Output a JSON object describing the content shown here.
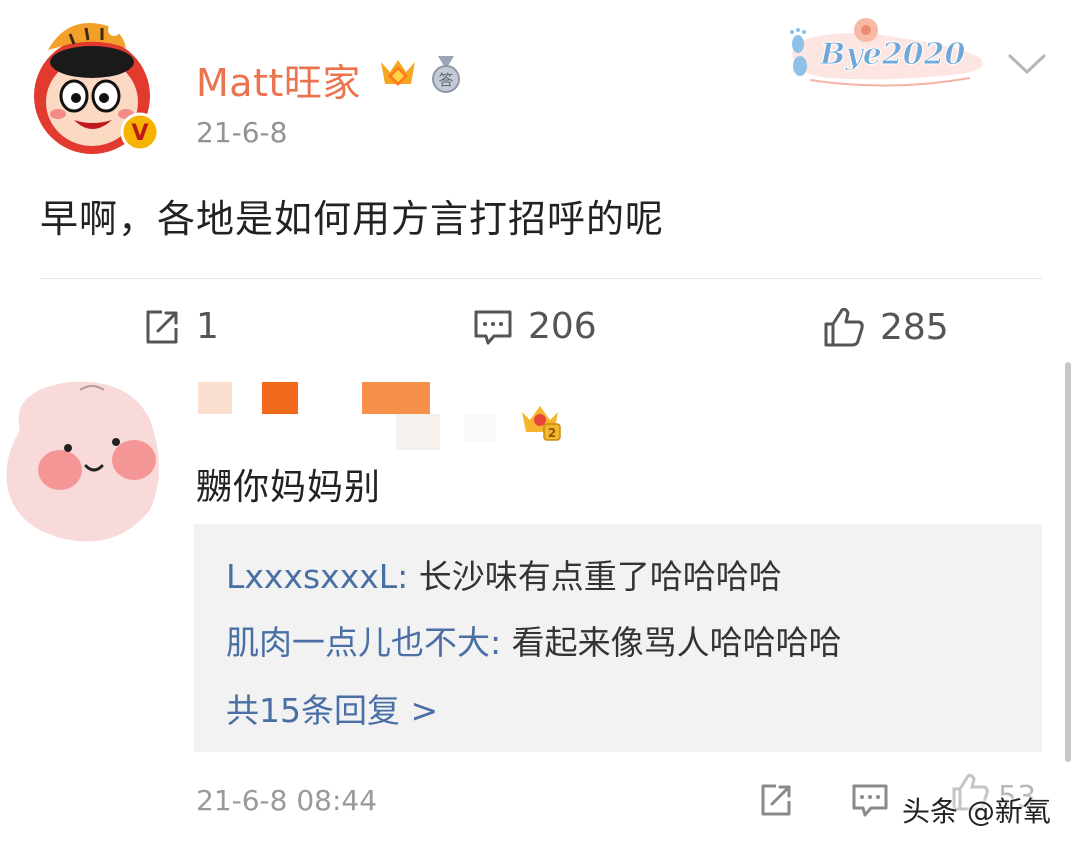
{
  "post": {
    "author": "Matt旺家",
    "date": "21-6-8",
    "text": "早啊，各地是如何用方言打招呼的呢",
    "sticker_text": "Bye2020"
  },
  "actions": {
    "repost_count": "1",
    "comment_count": "206",
    "like_count": "285"
  },
  "comment": {
    "text": "嬲你妈妈别",
    "replies": [
      {
        "name": "LxxxsxxxL",
        "sep": ": ",
        "text": "长沙味有点重了哈哈哈哈"
      },
      {
        "name": "肌肉一点儿也不大",
        "sep": ": ",
        "text": "看起来像骂人哈哈哈哈"
      }
    ],
    "more_replies": "共15条回复 >",
    "time": "21-6-8 08:44",
    "like_count": "53"
  },
  "watermark": "头条 @新氧",
  "colors": {
    "author": "#eb7350",
    "link": "#4a6fa5",
    "reply_bg": "#f2f2f2",
    "meta": "#9a9a9a"
  }
}
